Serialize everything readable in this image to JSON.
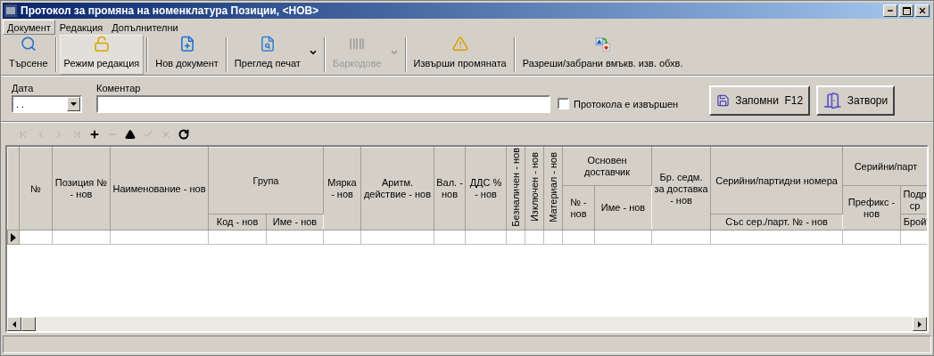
{
  "window": {
    "title": "Протокол за промяна на номенклатура Позиции, <НОВ>"
  },
  "menu": [
    {
      "label": "Документ",
      "selected": true
    },
    {
      "label": "Редакция",
      "selected": false
    },
    {
      "label": "Допълнителни",
      "selected": false
    }
  ],
  "toolbar": [
    {
      "kind": "search",
      "label": "Търсене",
      "selected": false,
      "disabled": false,
      "dropdown": false
    },
    {
      "kind": "edit",
      "label": "Режим редакция",
      "selected": true,
      "disabled": false,
      "dropdown": false
    },
    {
      "kind": "new",
      "label": "Нов документ",
      "selected": false,
      "disabled": false,
      "dropdown": false
    },
    {
      "kind": "preview",
      "label": "Преглед печат",
      "selected": false,
      "disabled": false,
      "dropdown": true
    },
    {
      "kind": "barcode",
      "label": "Баркодове",
      "selected": false,
      "disabled": true,
      "dropdown": true
    },
    {
      "kind": "warning",
      "label": "Извърши промяната",
      "selected": false,
      "disabled": false,
      "dropdown": false
    },
    {
      "kind": "toggle",
      "label": "Разреши/забрани вмъкв. изв. обхв.",
      "selected": false,
      "disabled": false,
      "dropdown": false
    }
  ],
  "form": {
    "date": {
      "label": "Дата",
      "value": ". ."
    },
    "comment": {
      "label": "Коментар"
    },
    "done_checkbox": {
      "label": "Протокола е извършен",
      "checked": false
    },
    "buttons": [
      {
        "kind": "save",
        "label": "Запомни  F12"
      },
      {
        "kind": "close",
        "label": "Затвори"
      }
    ]
  },
  "navigator": [
    {
      "kind": "first",
      "disabled": true
    },
    {
      "kind": "prev",
      "disabled": true
    },
    {
      "kind": "next",
      "disabled": true
    },
    {
      "kind": "last",
      "disabled": true
    },
    {
      "kind": "add",
      "disabled": false
    },
    {
      "kind": "delete",
      "disabled": true
    },
    {
      "kind": "up",
      "disabled": false
    },
    {
      "kind": "post",
      "disabled": true
    },
    {
      "kind": "cancel",
      "disabled": true
    },
    {
      "kind": "refresh",
      "disabled": false
    }
  ],
  "table": {
    "header_rows": [
      [
        {
          "kind": "text",
          "label": "№"
        },
        {
          "kind": "text",
          "label": "Позиция № - нов"
        },
        {
          "kind": "text",
          "label": "Наименование - нов"
        },
        {
          "kind": "text",
          "label": "Група"
        },
        {
          "kind": "text",
          "label": "Мярка - нов"
        },
        {
          "kind": "text",
          "label": "Аритм. действие - нов"
        },
        {
          "kind": "text",
          "label": "Вал. - нов"
        },
        {
          "kind": "text",
          "label": "ДДС % - нов"
        },
        {
          "kind": "vertical",
          "label": "Безналичен - нов"
        },
        {
          "kind": "vertical",
          "label": "Изключен - нов"
        },
        {
          "kind": "vertical",
          "label": "Материал - нов"
        },
        {
          "kind": "text",
          "label": "Основен доставчик"
        },
        {
          "kind": "text",
          "label": "Бр. седм. за доставка - нов"
        },
        {
          "kind": "text",
          "label": "Серийни/партидни номера"
        },
        {
          "kind": "text",
          "label": "Серийни/парт"
        }
      ],
      [
        {
          "kind": "text",
          "label": "№ - нов"
        },
        {
          "kind": "text",
          "label": "Име - нов"
        },
        {
          "kind": "text",
          "label": "Префикс - нов"
        },
        {
          "kind": "text",
          "label": "Подр ср"
        }
      ],
      [
        {
          "kind": "text",
          "label": "Код - нов"
        },
        {
          "kind": "text",
          "label": "Име - нов"
        },
        {
          "kind": "text",
          "label": "Със сер./парт. № - нов"
        },
        {
          "kind": "text",
          "label": "Брой"
        }
      ]
    ],
    "rows": [
      {
        "current": true
      }
    ]
  }
}
